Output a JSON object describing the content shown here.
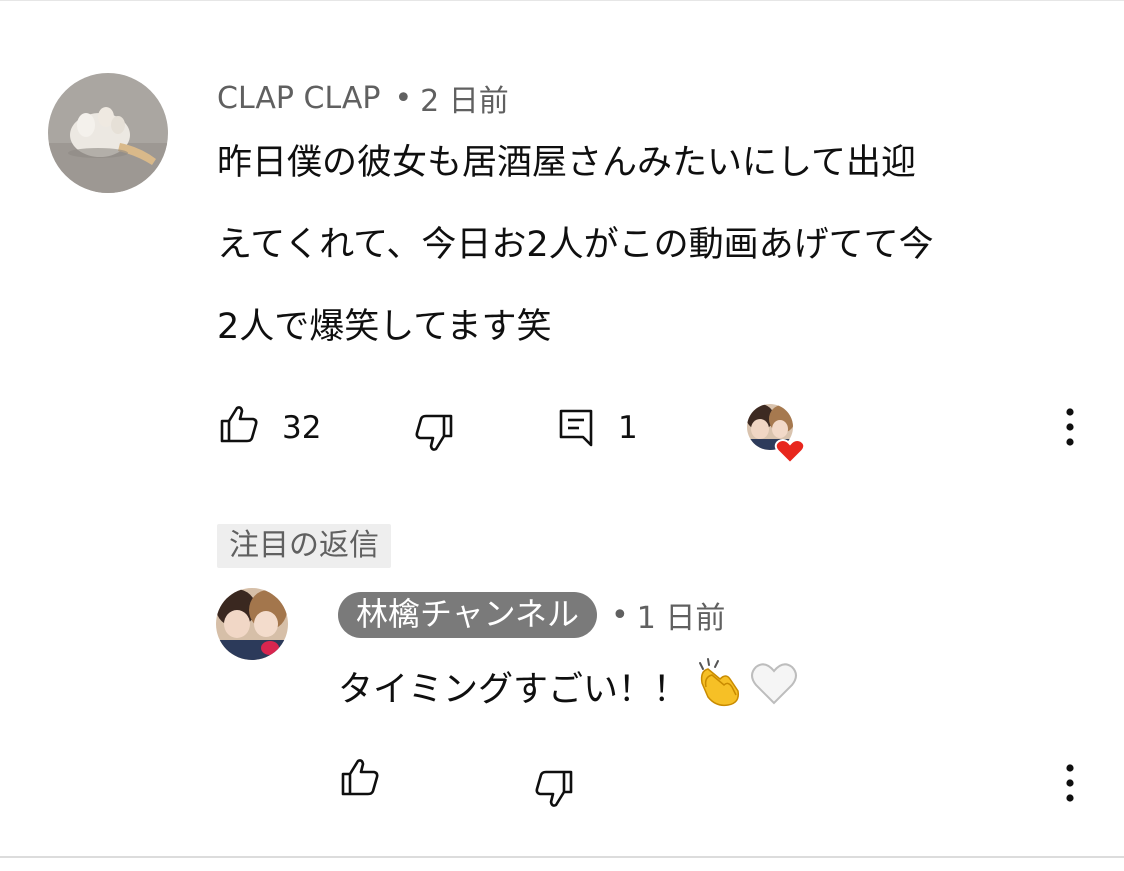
{
  "comment": {
    "author": "CLAP CLAP",
    "time": "2 日前",
    "text": "昨日僕の彼女も居酒屋さんみたいにして出迎\nえてくれて、今日お2人がこの動画あげてて今\n2人で爆笑してます笑",
    "like_count": "32",
    "reply_count": "1",
    "icons": [
      "like-icon",
      "dislike-icon",
      "reply-icon",
      "creator-heart-icon",
      "more-options-icon"
    ]
  },
  "pinned_label": "注目の返信",
  "reply": {
    "author": "林檎チャンネル",
    "time": "1 日前",
    "text": "タイミングすごい！！",
    "emojis": [
      "clapping-hands-emoji",
      "white-heart-emoji"
    ],
    "icons": [
      "like-icon",
      "dislike-icon",
      "more-options-icon"
    ]
  },
  "colors": {
    "text": "#0f0f0f",
    "meta": "#606060",
    "owner_chip_bg": "#7a7a7a",
    "heart": "#e8261d"
  },
  "separator": "•"
}
